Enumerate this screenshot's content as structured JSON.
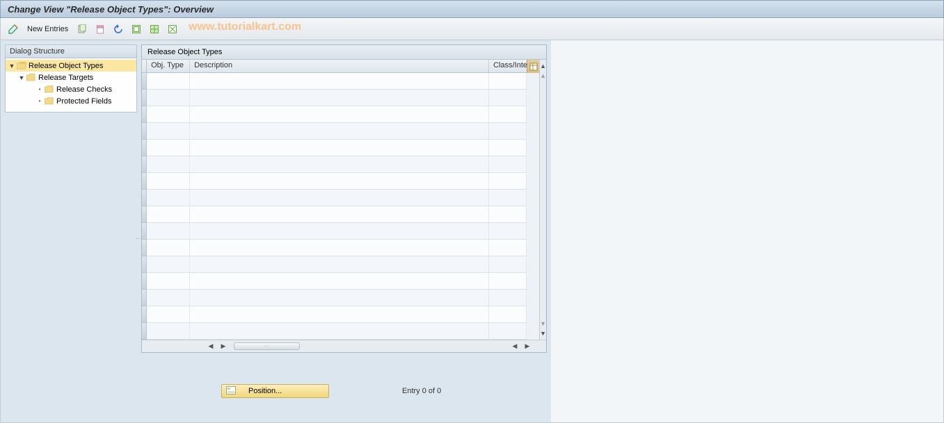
{
  "title": "Change View \"Release Object Types\": Overview",
  "toolbar": {
    "new_entries": "New Entries"
  },
  "watermark": "www.tutorialkart.com",
  "sidebar": {
    "header": "Dialog Structure",
    "nodes": {
      "root": "Release Object Types",
      "targets": "Release Targets",
      "checks": "Release Checks",
      "protected": "Protected Fields"
    }
  },
  "panel": {
    "title": "Release Object Types",
    "columns": {
      "obj": "Obj. Type",
      "desc": "Description",
      "cls": "Class/Inte"
    }
  },
  "footer": {
    "position": "Position...",
    "entry": "Entry 0 of 0"
  }
}
